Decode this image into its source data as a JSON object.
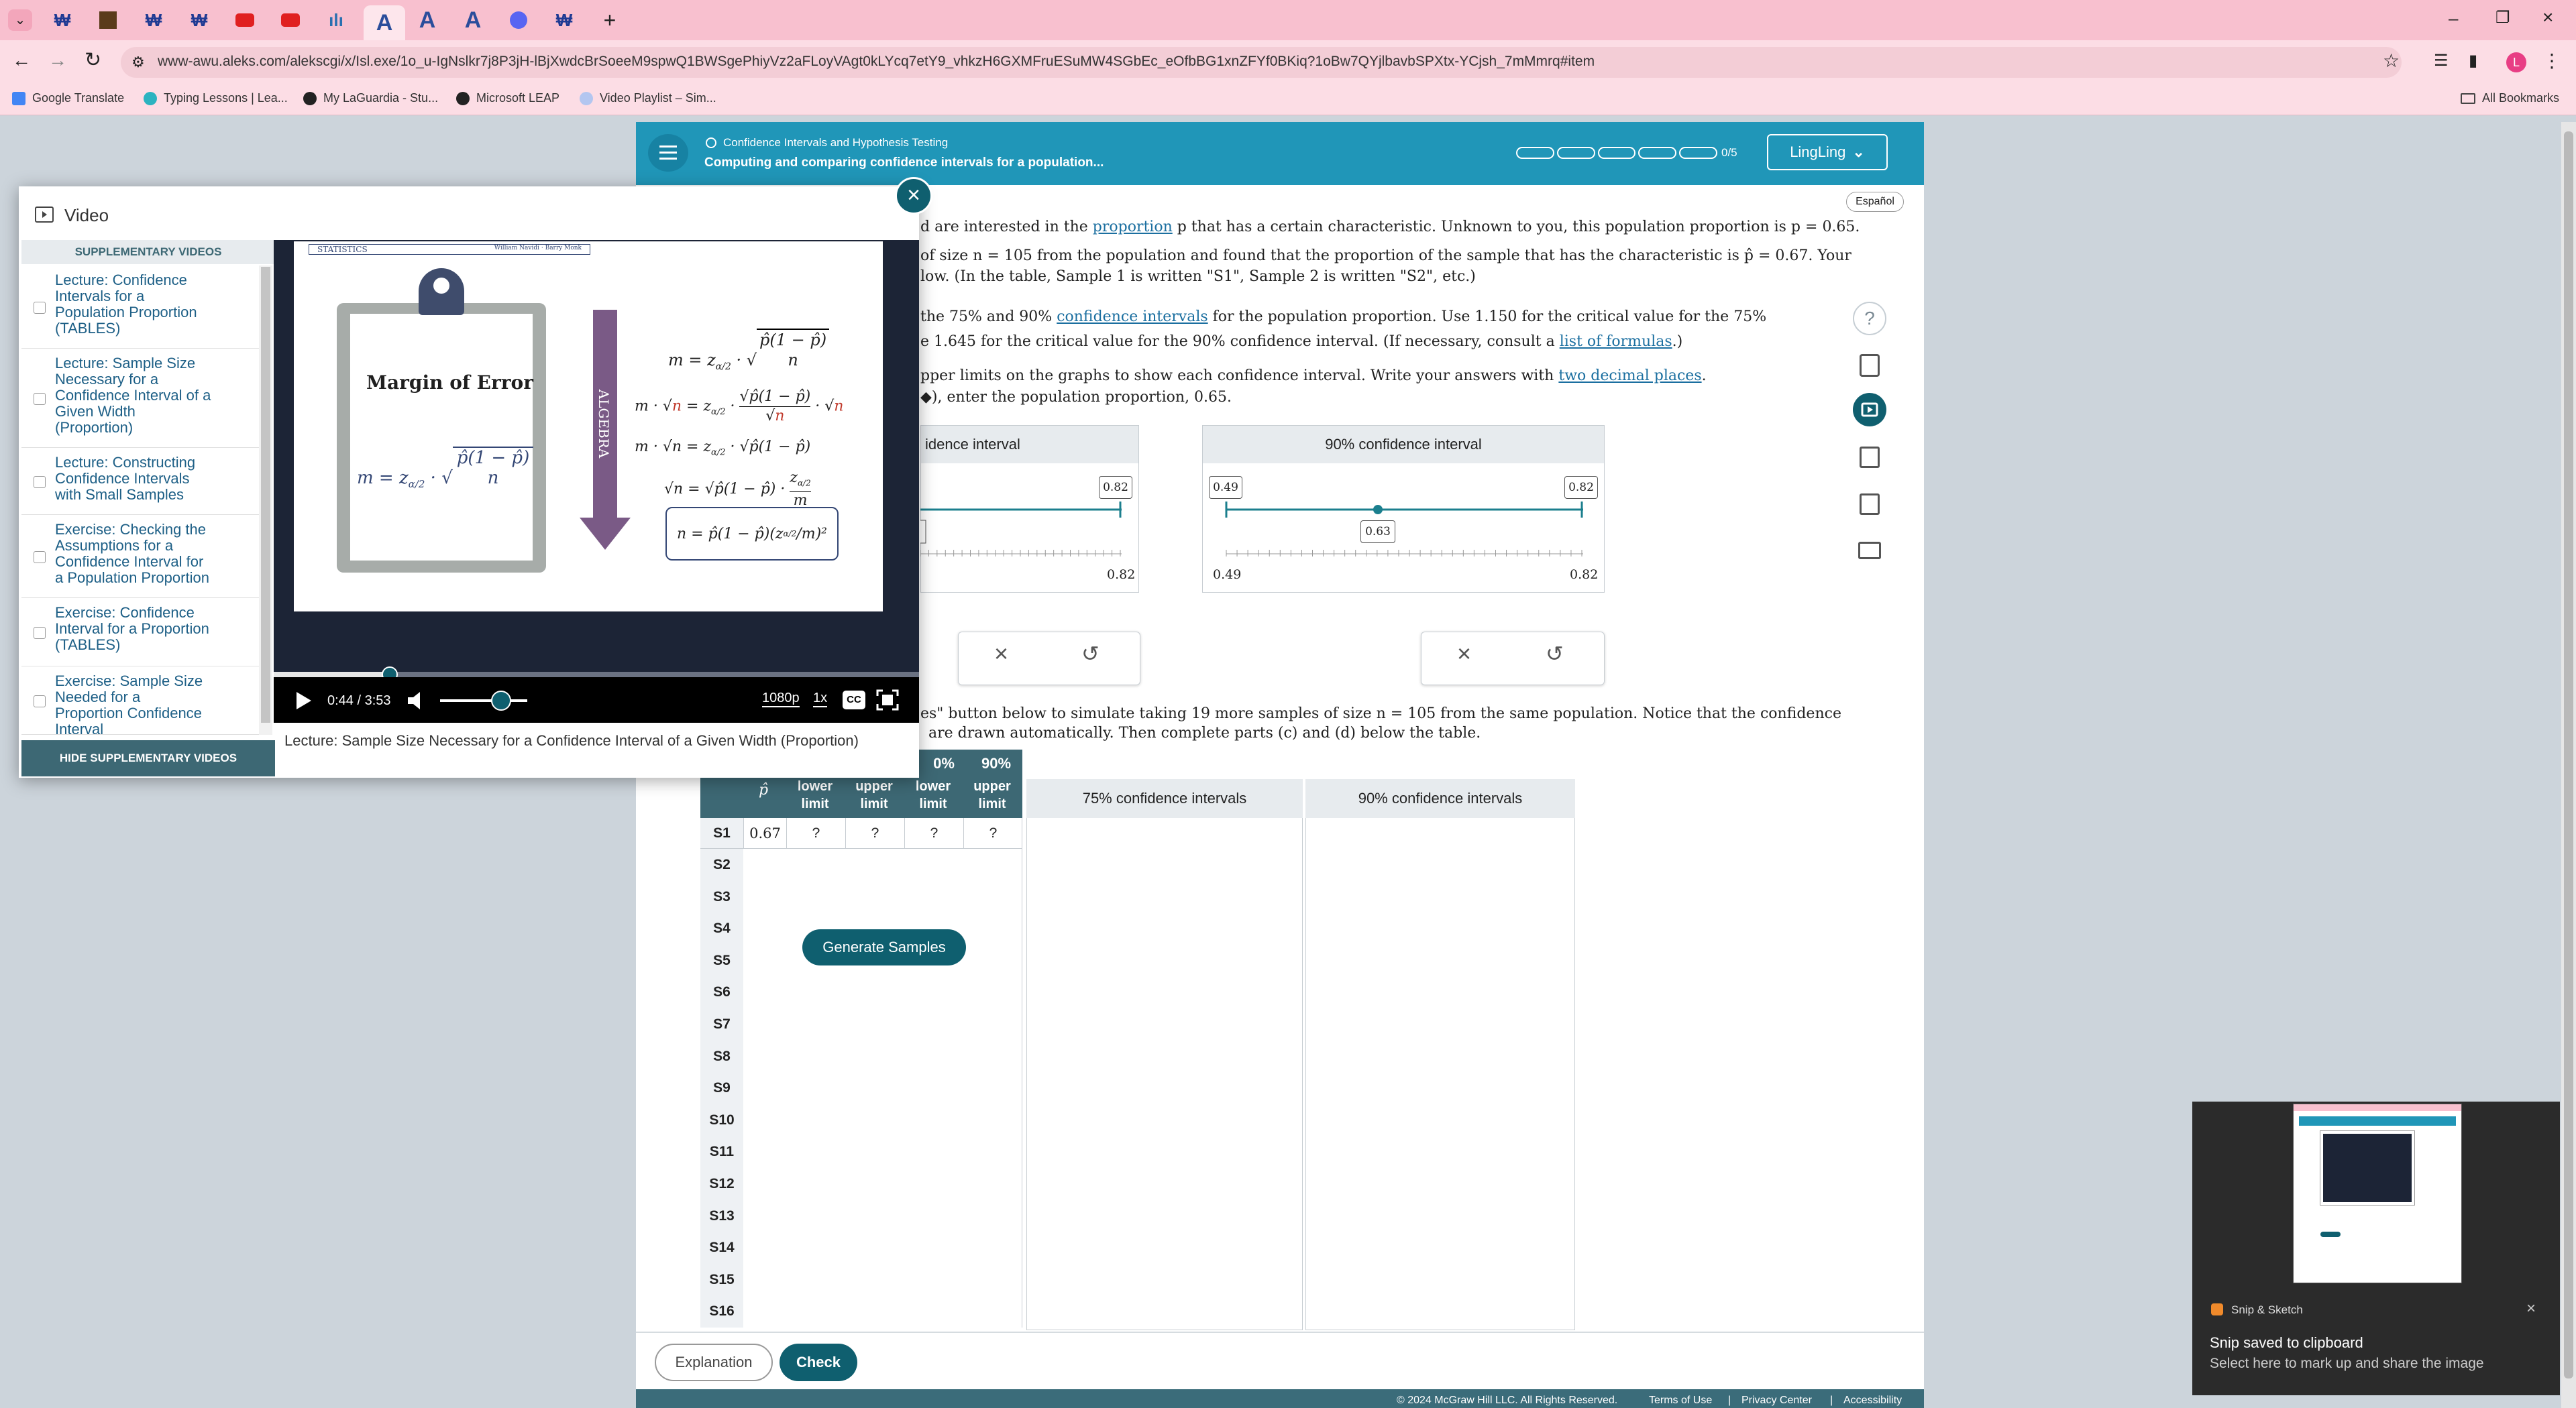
{
  "browser": {
    "url": "www-awu.aleks.com/alekscgi/x/Isl.exe/1o_u-IgNslkr7j8P3jH-lBjXwdcBrSoeeM9spwQ1BWSgePhiyVz2aFLoyVAgt0kLYcq7etY9_vhkzH6GXMFruESuMW4SGbEc_eOfbBG1xnZFYf0BKiq?1oBw7QYjlbavbSPXtx-YCjsh_7mMmrq#item",
    "tabs": [
      "A",
      "A",
      "A"
    ],
    "bookmarks": [
      "Google Translate",
      "Typing Lessons | Lea...",
      "My LaGuardia - Stu...",
      "Microsoft LEAP",
      "Video Playlist – Sim..."
    ],
    "all_bookmarks": "All Bookmarks",
    "profile_initial": "L"
  },
  "aleks": {
    "topic": "Confidence Intervals and Hypothesis Testing",
    "title": "Computing and comparing confidence intervals for a population...",
    "progress": "0/5",
    "user": "LingLing",
    "language": "Español",
    "para1a": "d are interested in the",
    "para1_link": "proportion",
    "para1b": "p that has a certain characteristic. Unknown to you, this population proportion is p = 0.65.",
    "para2": "of size n = 105 from the population and found that the proportion of the sample that has the characteristic is p̂ = 0.67. Your",
    "para3": "low. (In the table, Sample 1 is written \"S1\", Sample 2 is written \"S2\", etc.)",
    "para4a": "the 75% and 90%",
    "para4_link": "confidence intervals",
    "para4b": "for the population proportion. Use 1.150 for the critical value for the 75%",
    "para5a": "e 1.645 for the critical value for the 90% confidence interval. (If necessary, consult a",
    "para5_link": "list of formulas",
    "para5b": ".)",
    "para6a": "pper limits on the graphs to show each confidence interval. Write your answers with",
    "para6_link": "two decimal places",
    "para6b": ".",
    "para7": "◆), enter the population proportion, 0.65.",
    "graph75_title": "idence interval",
    "graph90_title": "90% confidence interval",
    "g75_upper": "0.82",
    "g75_axis_right": "0.82",
    "g90_lower": "0.49",
    "g90_upper": "0.82",
    "g90_mid": "0.63",
    "g90_axis_left": "0.49",
    "g90_axis_right": "0.82",
    "para8a": "es\" button below to simulate taking 19 more samples of size n = 105 from the same population. Notice that the confidence",
    "para8b": "are drawn automatically. Then complete parts (c) and (d) below the table.",
    "table_head": [
      "p̂",
      "lower limit",
      "upper limit",
      "lower limit",
      "upper limit"
    ],
    "table_group": [
      "0%",
      "90%"
    ],
    "s1": [
      "0.67",
      "?",
      "?",
      "?",
      "?"
    ],
    "rows": [
      "S1",
      "S2",
      "S3",
      "S4",
      "S5",
      "S6",
      "S7",
      "S8",
      "S9",
      "S10",
      "S11",
      "S12",
      "S13",
      "S14",
      "S15",
      "S16"
    ],
    "generate": "Generate Samples",
    "col75": "75% confidence intervals",
    "col90": "90% confidence intervals",
    "explanation": "Explanation",
    "check": "Check",
    "footer": [
      "© 2024 McGraw Hill LLC. All Rights Reserved.",
      "Terms of Use",
      "|",
      "Privacy Center",
      "|",
      "Accessibility"
    ],
    "clear": "×",
    "undo": "↺"
  },
  "video": {
    "heading": "Video",
    "supp_header": "SUPPLEMENTARY VIDEOS",
    "items": [
      "Lecture: Confidence\nIntervals for a\nPopulation Proportion\n(TABLES)",
      "Lecture: Sample Size\nNecessary for a\nConfidence Interval of a\nGiven Width\n(Proportion)",
      "Lecture: Constructing\nConfidence Intervals\nwith Small Samples",
      "Exercise: Checking the\nAssumptions for a\nConfidence Interval for\na Population Proportion",
      "Exercise: Confidence\nInterval for a Proportion\n(TABLES)",
      "Exercise: Sample Size\nNeeded for a\nProportion Confidence\nInterval"
    ],
    "hide": "HIDE SUPPLEMENTARY VIDEOS",
    "slide_banner": "STATISTICS",
    "slide_authors": "William Navidi · Barry Monk",
    "margin_title": "Margin of Error",
    "algebra": "ALGEBRA",
    "time": "0:44 / 3:53",
    "quality": "1080p",
    "speed": "1x",
    "cc": "CC",
    "caption": "Lecture: Sample Size Necessary for a Confidence Interval of a Given Width (Proportion)",
    "progress_fraction": 0.18,
    "volume_fraction": 0.7
  },
  "snip": {
    "app": "Snip & Sketch",
    "title": "Snip saved to clipboard",
    "body": "Select here to mark up and share the image"
  },
  "colors": {
    "aleks_teal": "#2096b8",
    "dark_teal": "#0f5f6f",
    "chrome_pink": "#f8c0cf"
  }
}
